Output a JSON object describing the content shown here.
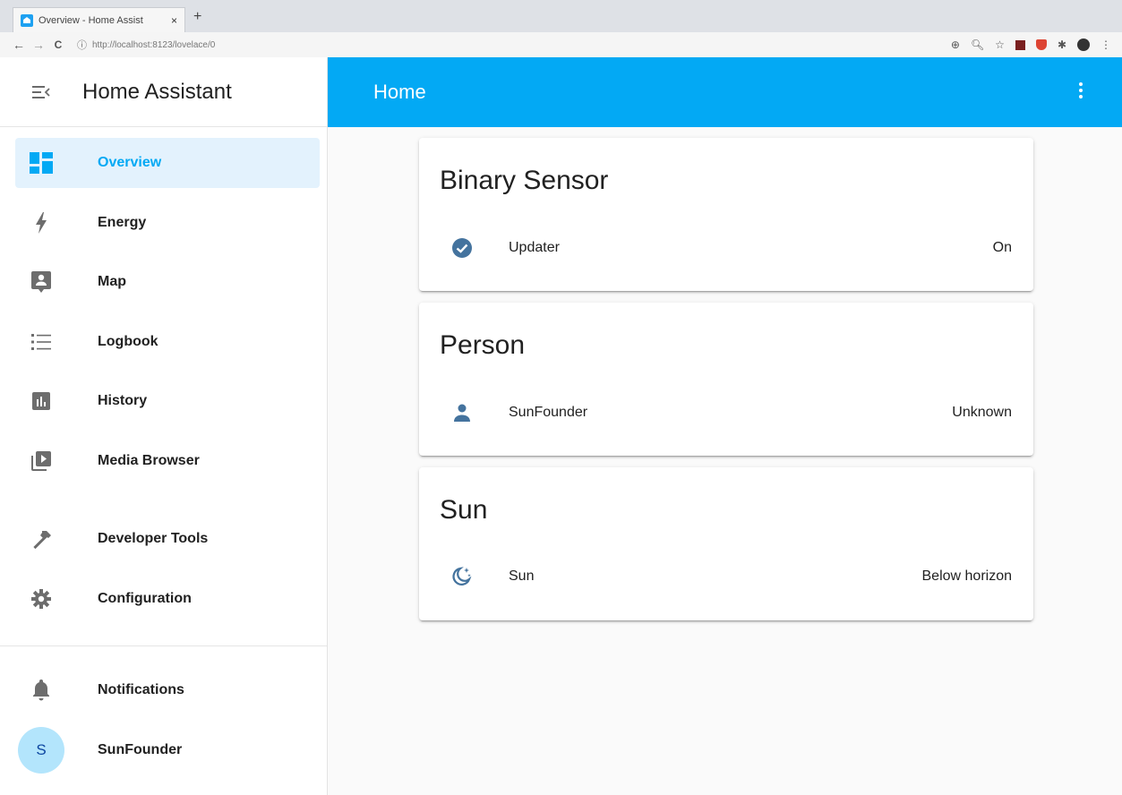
{
  "browser": {
    "tab_title": "Overview - Home Assist",
    "tab_close": "×",
    "new_tab": "+",
    "back": "←",
    "forward": "→",
    "reload": "C",
    "url": "http://localhost:8123/lovelace/0"
  },
  "sidebar": {
    "title": "Home Assistant",
    "items": [
      {
        "label": "Overview",
        "icon": "dashboard-icon",
        "active": true
      },
      {
        "label": "Energy",
        "icon": "lightning-bolt-icon"
      },
      {
        "label": "Map",
        "icon": "map-account-icon"
      },
      {
        "label": "Logbook",
        "icon": "list-icon"
      },
      {
        "label": "History",
        "icon": "chart-box-icon"
      },
      {
        "label": "Media Browser",
        "icon": "play-box-multiple-icon"
      },
      {
        "label": "Developer Tools",
        "icon": "hammer-icon"
      },
      {
        "label": "Configuration",
        "icon": "cog-icon"
      }
    ],
    "notifications_label": "Notifications",
    "user": {
      "initial": "S",
      "name": "SunFounder"
    }
  },
  "topbar": {
    "title": "Home"
  },
  "cards": [
    {
      "title": "Binary Sensor",
      "entity": {
        "name": "Updater",
        "state": "On",
        "icon": "check-circle-icon"
      }
    },
    {
      "title": "Person",
      "entity": {
        "name": "SunFounder",
        "state": "Unknown",
        "icon": "account-icon"
      }
    },
    {
      "title": "Sun",
      "entity": {
        "name": "Sun",
        "state": "Below horizon",
        "icon": "weather-night-icon"
      }
    }
  ],
  "colors": {
    "accent": "#03a9f4",
    "active_bg": "#e3f2fd",
    "entity_icon": "#44739e"
  }
}
